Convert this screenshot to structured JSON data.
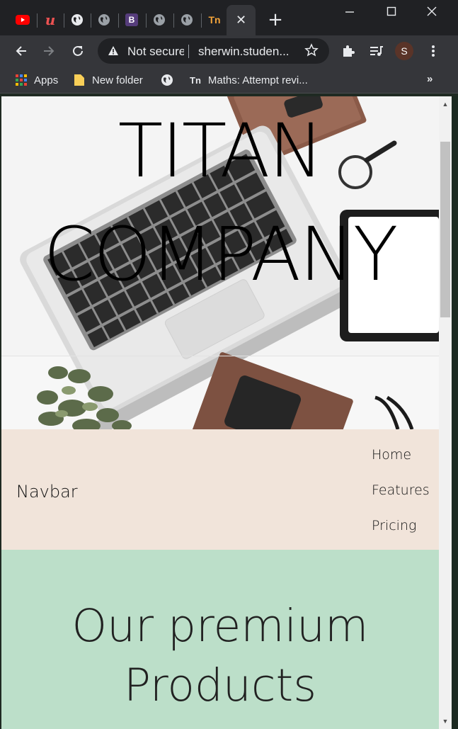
{
  "browser": {
    "tabs": [
      {
        "icon": "youtube-icon",
        "color": "#ff0000"
      },
      {
        "icon": "udemy-icon",
        "color": "#ec5252"
      },
      {
        "icon": "globe-icon",
        "color": "#e8eaed"
      },
      {
        "icon": "globe-icon",
        "color": "#9aa0a6"
      },
      {
        "icon": "bootstrap-icon",
        "letter": "B",
        "color": "#563d7c"
      },
      {
        "icon": "globe-icon",
        "color": "#9aa0a6"
      },
      {
        "icon": "globe-icon",
        "color": "#9aa0a6"
      },
      {
        "icon": "tm-icon",
        "letter": "Tn",
        "color": "#f2a33a"
      }
    ],
    "active_tab_close": "✕",
    "new_tab": "+",
    "address": {
      "security_label": "Not secure",
      "url": "sherwin.studen..."
    },
    "profile_initial": "S",
    "bookmarks": [
      {
        "label": "Apps",
        "icon": "apps-grid-icon"
      },
      {
        "label": "New folder",
        "icon": "folder-icon"
      },
      {
        "label": "",
        "icon": "globe-icon"
      },
      {
        "label": "Maths: Attempt revi...",
        "icon": "tm-icon"
      }
    ],
    "bookmarks_overflow": "»"
  },
  "page": {
    "hero": {
      "title_line1": "TITAN",
      "title_line2": "COMPANY"
    },
    "navbar": {
      "brand": "Navbar",
      "links": [
        "Home",
        "Features",
        "Pricing"
      ]
    },
    "products": {
      "title_line1": "Our premium",
      "title_line2": "Products"
    }
  },
  "colors": {
    "navbar_bg": "#f1e4da",
    "products_bg": "#bcdfc9",
    "chrome_dark": "#202124",
    "chrome_toolbar": "#35363a"
  }
}
